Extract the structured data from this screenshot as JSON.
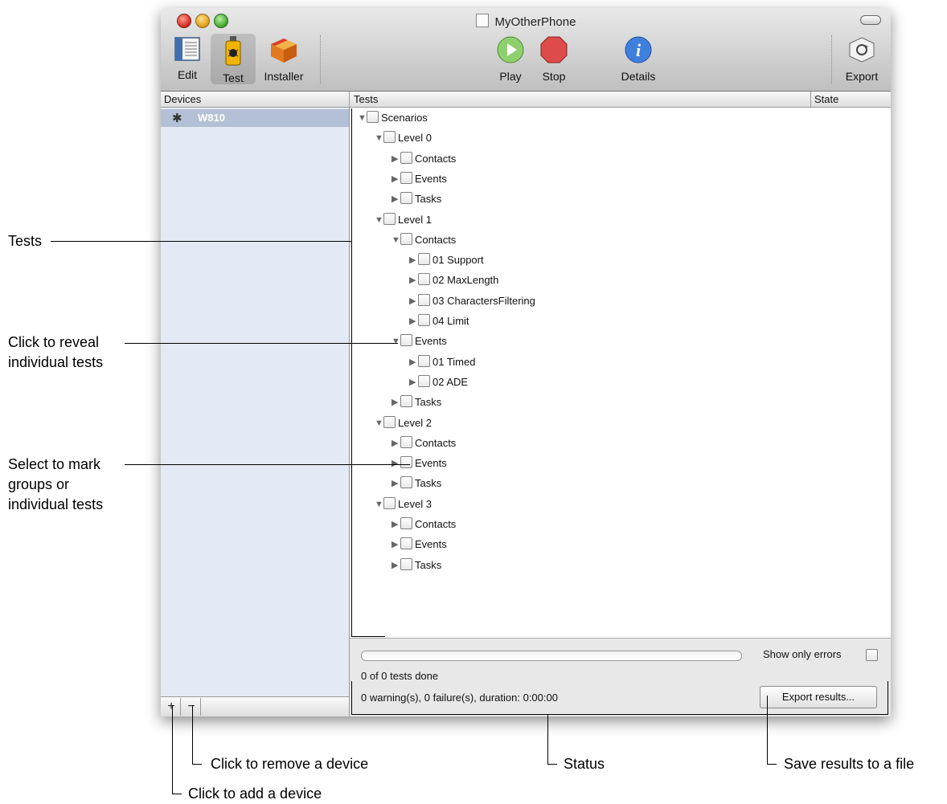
{
  "window": {
    "title": "MyOtherPhone"
  },
  "toolbar": {
    "edit": "Edit",
    "test": "Test",
    "installer": "Installer",
    "play": "Play",
    "stop": "Stop",
    "details": "Details",
    "export": "Export"
  },
  "devices": {
    "header": "Devices",
    "items": [
      {
        "name": "W810"
      }
    ],
    "add": "+",
    "remove": "−"
  },
  "tests": {
    "header": "Tests",
    "state_header": "State",
    "tree": [
      {
        "label": "Scenarios",
        "level": 0,
        "expanded": true
      },
      {
        "label": "Level 0",
        "level": 1,
        "expanded": true
      },
      {
        "label": "Contacts",
        "level": 2,
        "expanded": false
      },
      {
        "label": "Events",
        "level": 2,
        "expanded": false
      },
      {
        "label": "Tasks",
        "level": 2,
        "expanded": false
      },
      {
        "label": "Level 1",
        "level": 1,
        "expanded": true
      },
      {
        "label": "Contacts",
        "level": 2,
        "expanded": true
      },
      {
        "label": "01 Support",
        "level": 3,
        "expanded": false
      },
      {
        "label": "02 MaxLength",
        "level": 3,
        "expanded": false
      },
      {
        "label": "03 CharactersFiltering",
        "level": 3,
        "expanded": false
      },
      {
        "label": "04 Limit",
        "level": 3,
        "expanded": false
      },
      {
        "label": "Events",
        "level": 2,
        "expanded": true
      },
      {
        "label": "01 Timed",
        "level": 3,
        "expanded": false
      },
      {
        "label": "02 ADE",
        "level": 3,
        "expanded": false
      },
      {
        "label": "Tasks",
        "level": 2,
        "expanded": false
      },
      {
        "label": "Level 2",
        "level": 1,
        "expanded": true
      },
      {
        "label": "Contacts",
        "level": 2,
        "expanded": false
      },
      {
        "label": "Events",
        "level": 2,
        "expanded": false
      },
      {
        "label": "Tasks",
        "level": 2,
        "expanded": false
      },
      {
        "label": "Level 3",
        "level": 1,
        "expanded": true
      },
      {
        "label": "Contacts",
        "level": 2,
        "expanded": false
      },
      {
        "label": "Events",
        "level": 2,
        "expanded": false
      },
      {
        "label": "Tasks",
        "level": 2,
        "expanded": false
      }
    ]
  },
  "status": {
    "progress": 0,
    "show_only_errors": "Show only errors",
    "done": "0 of 0 tests done",
    "summary": "0 warning(s), 0 failure(s), duration: 0:00:00",
    "export_results": "Export results..."
  },
  "callouts": {
    "tests": "Tests",
    "reveal_1": "Click to reveal",
    "reveal_2": "individual tests",
    "select_1": "Select to mark",
    "select_2": "groups or",
    "select_3": "individual tests",
    "remove": "Click to remove a device",
    "status": "Status",
    "save": "Save results to a file",
    "add": "Click to add a device"
  }
}
